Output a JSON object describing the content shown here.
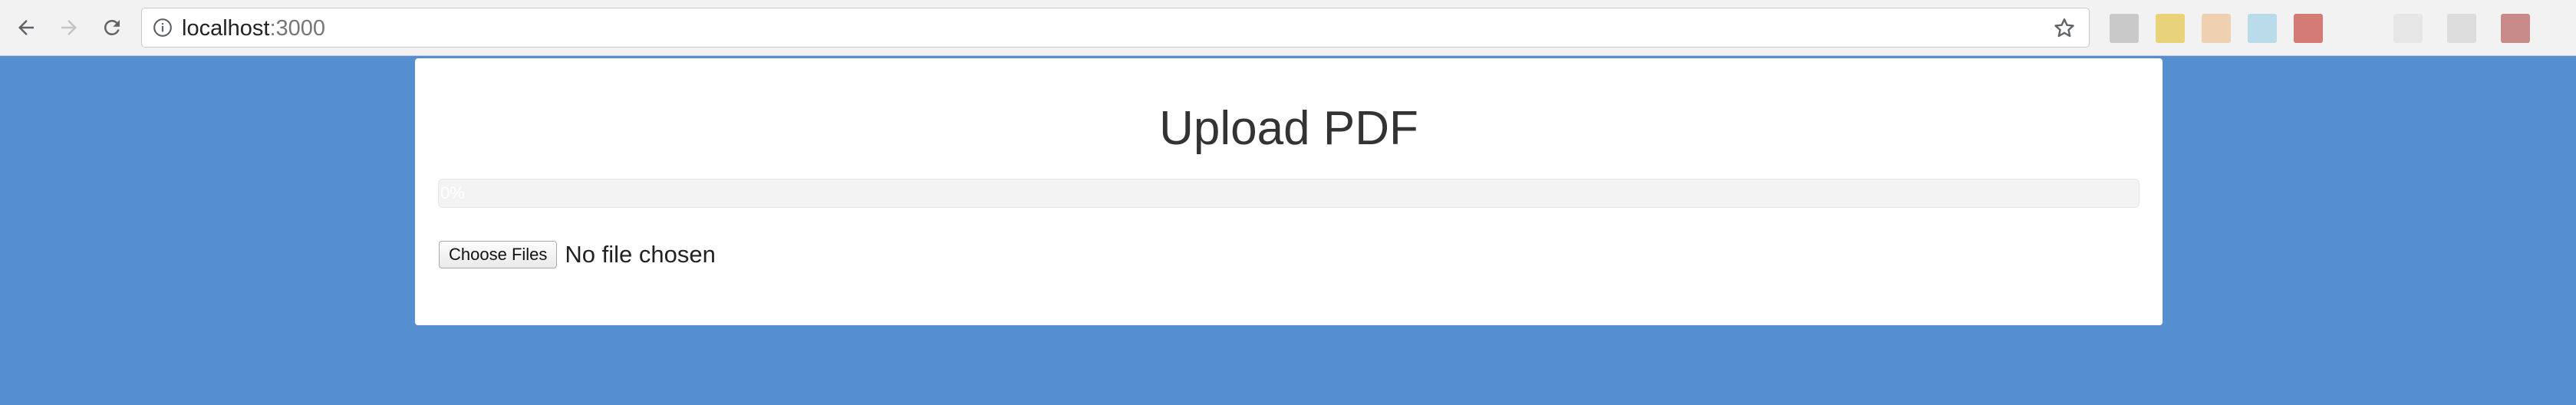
{
  "browser": {
    "url_host": "localhost",
    "url_port": ":3000"
  },
  "extensions": [
    {
      "name": "extension-1",
      "color": "#c9c9c9"
    },
    {
      "name": "extension-2",
      "color": "#e9d37a"
    },
    {
      "name": "extension-3",
      "color": "#efd0b0"
    },
    {
      "name": "extension-4",
      "color": "#b9dbea"
    },
    {
      "name": "extension-5",
      "color": "#d57b76"
    },
    {
      "name": "extension-6",
      "color": "#e6e6e6"
    },
    {
      "name": "extension-7",
      "color": "#dcdcdc"
    },
    {
      "name": "extension-8",
      "color": "#c98a8a"
    }
  ],
  "page": {
    "background": "#568fcf",
    "title": "Upload PDF",
    "progress": {
      "value_percent": 0,
      "label": "0%"
    },
    "file_input": {
      "button_label": "Choose Files",
      "status": "No file chosen"
    }
  }
}
